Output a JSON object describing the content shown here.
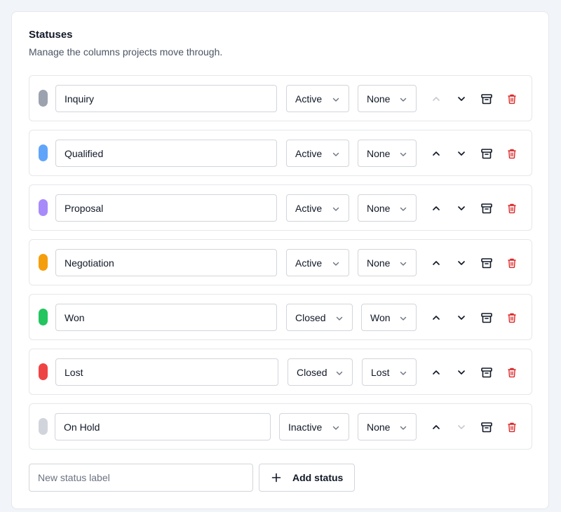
{
  "section": {
    "title": "Statuses",
    "subtitle": "Manage the columns projects move through."
  },
  "colors": {
    "gray": "#9ca3af",
    "blue": "#60a5fa",
    "purple": "#a78bfa",
    "orange": "#f59e0b",
    "green": "#22c55e",
    "red": "#ef4444",
    "lightgray": "#d1d5db",
    "danger": "#dc2626"
  },
  "statuses": [
    {
      "label": "Inquiry",
      "color": "#9ca3af",
      "state": "Active",
      "outcome": "None",
      "up_enabled": false,
      "down_enabled": true
    },
    {
      "label": "Qualified",
      "color": "#60a5fa",
      "state": "Active",
      "outcome": "None",
      "up_enabled": true,
      "down_enabled": true
    },
    {
      "label": "Proposal",
      "color": "#a78bfa",
      "state": "Active",
      "outcome": "None",
      "up_enabled": true,
      "down_enabled": true
    },
    {
      "label": "Negotiation",
      "color": "#f59e0b",
      "state": "Active",
      "outcome": "None",
      "up_enabled": true,
      "down_enabled": true
    },
    {
      "label": "Won",
      "color": "#22c55e",
      "state": "Closed",
      "outcome": "Won",
      "up_enabled": true,
      "down_enabled": true
    },
    {
      "label": "Lost",
      "color": "#ef4444",
      "state": "Closed",
      "outcome": "Lost",
      "up_enabled": true,
      "down_enabled": true
    },
    {
      "label": "On Hold",
      "color": "#d1d5db",
      "state": "Inactive",
      "outcome": "None",
      "up_enabled": true,
      "down_enabled": false
    }
  ],
  "icons": {
    "move_up": "chevron-up-icon",
    "move_down": "chevron-down-icon",
    "archive": "archive-icon",
    "delete": "trash-icon",
    "select": "chevron-down-icon",
    "add": "plus-icon"
  },
  "new_status": {
    "placeholder": "New status label",
    "value": "",
    "add_label": "Add status"
  }
}
